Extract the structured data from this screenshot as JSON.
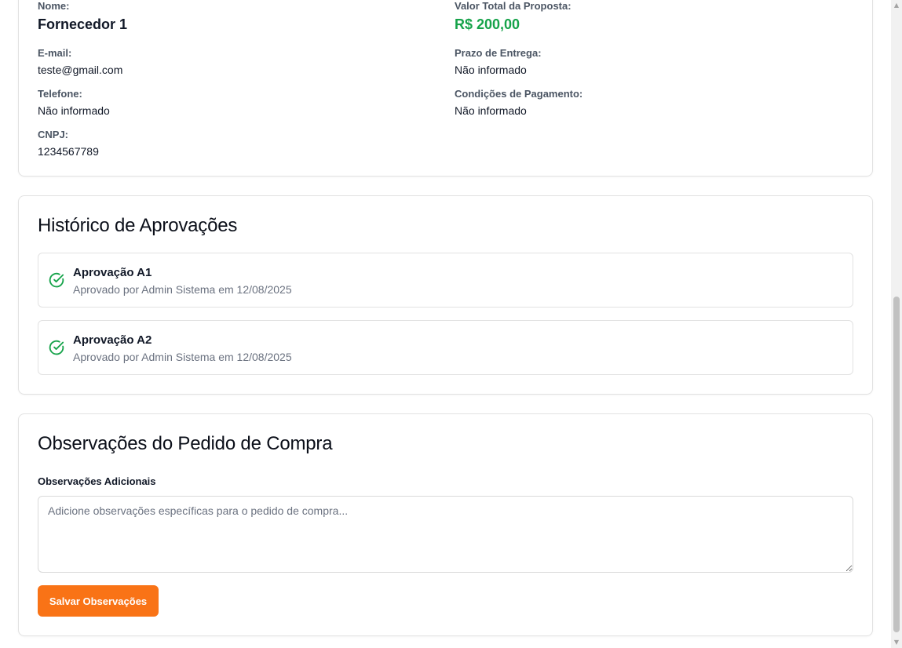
{
  "supplier": {
    "name_label": "Nome:",
    "name_value": "Fornecedor 1",
    "email_label": "E-mail:",
    "email_value": "teste@gmail.com",
    "phone_label": "Telefone:",
    "phone_value": "Não informado",
    "cnpj_label": "CNPJ:",
    "cnpj_value": "1234567789",
    "total_label": "Valor Total da Proposta:",
    "total_value": "R$ 200,00",
    "delivery_label": "Prazo de Entrega:",
    "delivery_value": "Não informado",
    "payment_label": "Condições de Pagamento:",
    "payment_value": "Não informado"
  },
  "history": {
    "title": "Histórico de Aprovações",
    "items": [
      {
        "title": "Aprovação A1",
        "meta": "Aprovado por Admin Sistema em 12/08/2025"
      },
      {
        "title": "Aprovação A2",
        "meta": "Aprovado por Admin Sistema em 12/08/2025"
      }
    ]
  },
  "notes": {
    "title": "Observações do Pedido de Compra",
    "label": "Observações Adicionais",
    "placeholder": "Adicione observações específicas para o pedido de compra...",
    "value": "",
    "save_label": "Salvar Observações"
  },
  "colors": {
    "accent": "#f97316",
    "money": "#16a34a",
    "approved": "#16a34a"
  },
  "icons": {
    "approved": "check-circle-icon",
    "scroll_up": "scroll-up-arrow-icon",
    "scroll_down": "scroll-down-arrow-icon"
  }
}
